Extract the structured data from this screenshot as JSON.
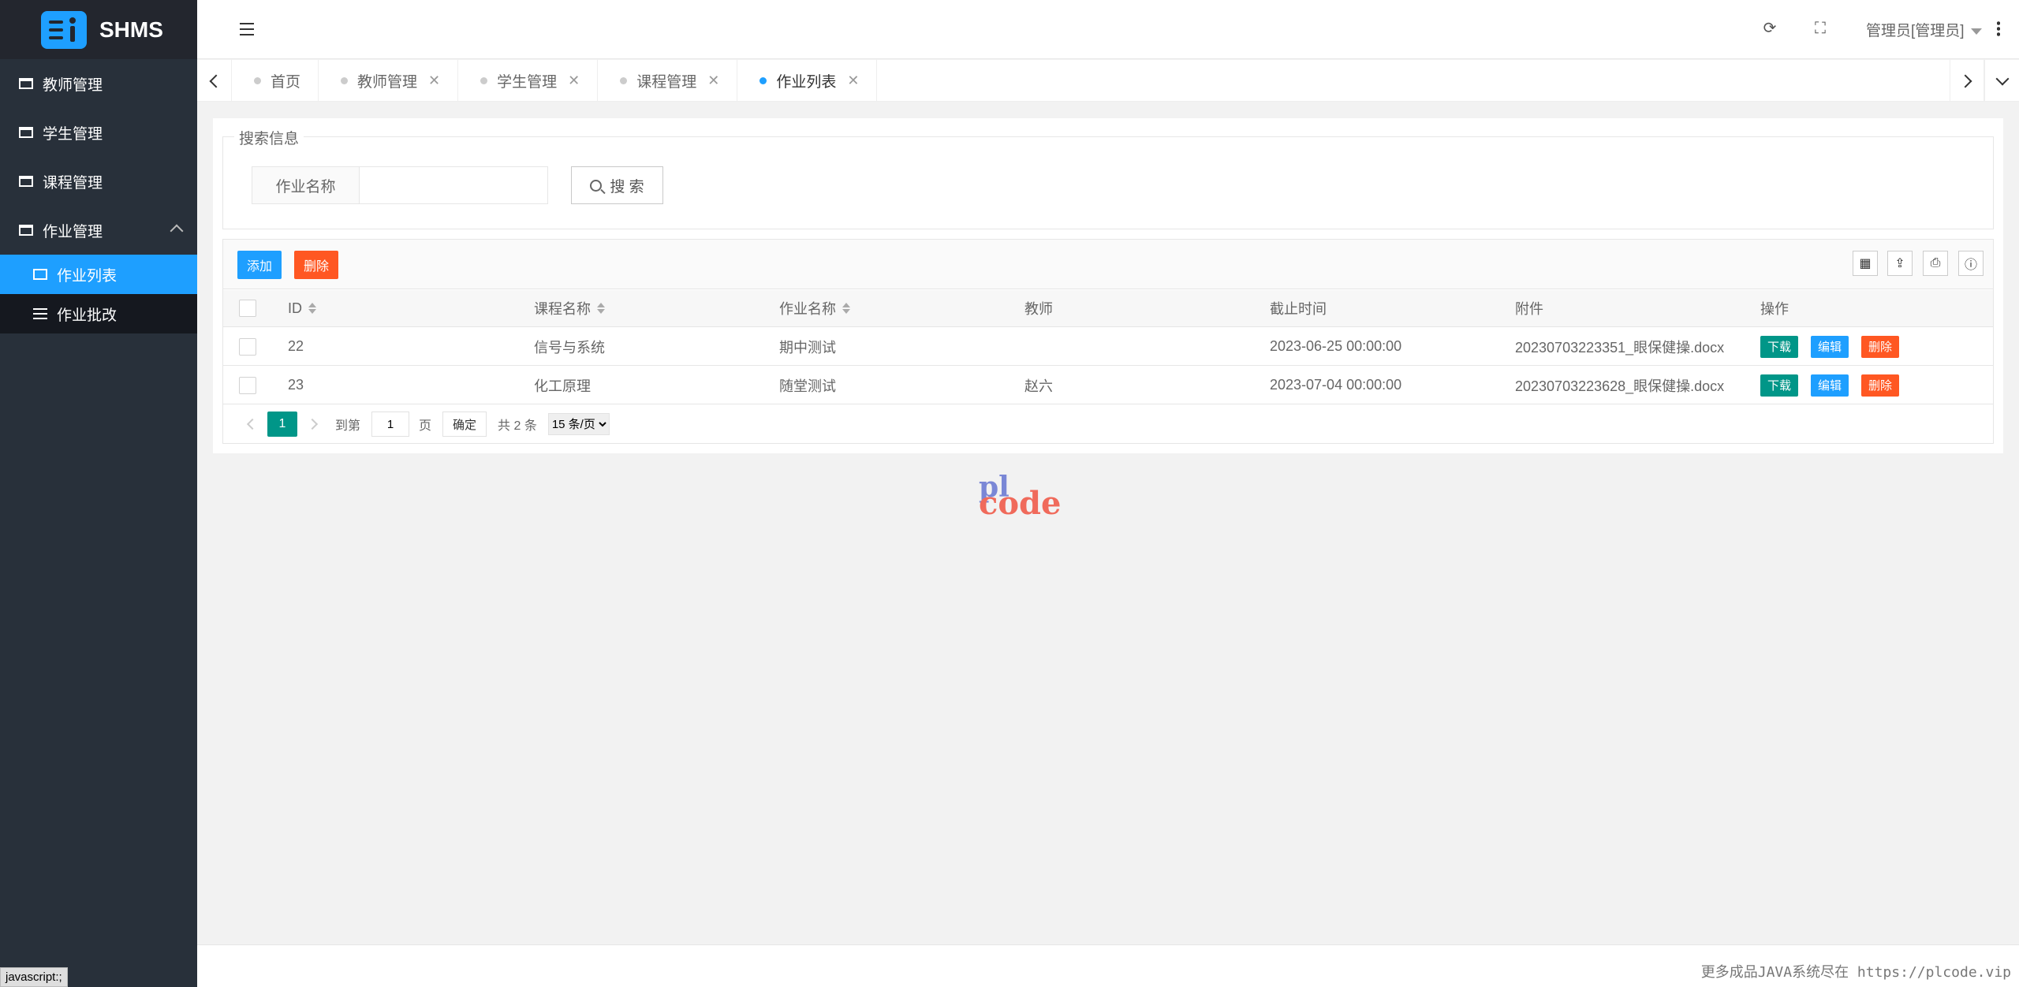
{
  "app": {
    "name": "SHMS"
  },
  "sidebar": {
    "items": [
      {
        "label": "教师管理"
      },
      {
        "label": "学生管理"
      },
      {
        "label": "课程管理"
      },
      {
        "label": "作业管理"
      }
    ],
    "sub_items": [
      {
        "label": "作业列表"
      },
      {
        "label": "作业批改"
      }
    ]
  },
  "header": {
    "user": "管理员[管理员]"
  },
  "tabs": [
    {
      "label": "首页"
    },
    {
      "label": "教师管理"
    },
    {
      "label": "学生管理"
    },
    {
      "label": "课程管理"
    },
    {
      "label": "作业列表"
    }
  ],
  "search": {
    "legend": "搜索信息",
    "field_label": "作业名称",
    "value": "",
    "button": "搜 索"
  },
  "toolbar": {
    "add": "添加",
    "delete": "删除"
  },
  "table": {
    "columns": [
      "ID",
      "课程名称",
      "作业名称",
      "教师",
      "截止时间",
      "附件",
      "操作"
    ],
    "rows": [
      {
        "id": "22",
        "course": "信号与系统",
        "name": "期中测试",
        "teacher": "",
        "deadline": "2023-06-25 00:00:00",
        "attachment": "20230703223351_眼保健操.docx"
      },
      {
        "id": "23",
        "course": "化工原理",
        "name": "随堂测试",
        "teacher": "赵六",
        "deadline": "2023-07-04 00:00:00",
        "attachment": "20230703223628_眼保健操.docx"
      }
    ],
    "row_actions": {
      "download": "下载",
      "edit": "编辑",
      "delete": "删除"
    }
  },
  "pager": {
    "current": "1",
    "goto": "到第",
    "page_value": "1",
    "page_unit": "页",
    "confirm": "确定",
    "total": "共 2 条",
    "per_page": "15 条/页"
  },
  "watermark": {
    "top": "pl",
    "bottom": "code"
  },
  "footer": {
    "text": "更多成品JAVA系统尽在 https://plcode.vip"
  },
  "status_bar": "javascript:;",
  "colors": {
    "primary": "#1e9fff",
    "danger": "#ff5722",
    "teal": "#009688",
    "edit": "#1e9fff",
    "sidebar": "#28303a"
  }
}
